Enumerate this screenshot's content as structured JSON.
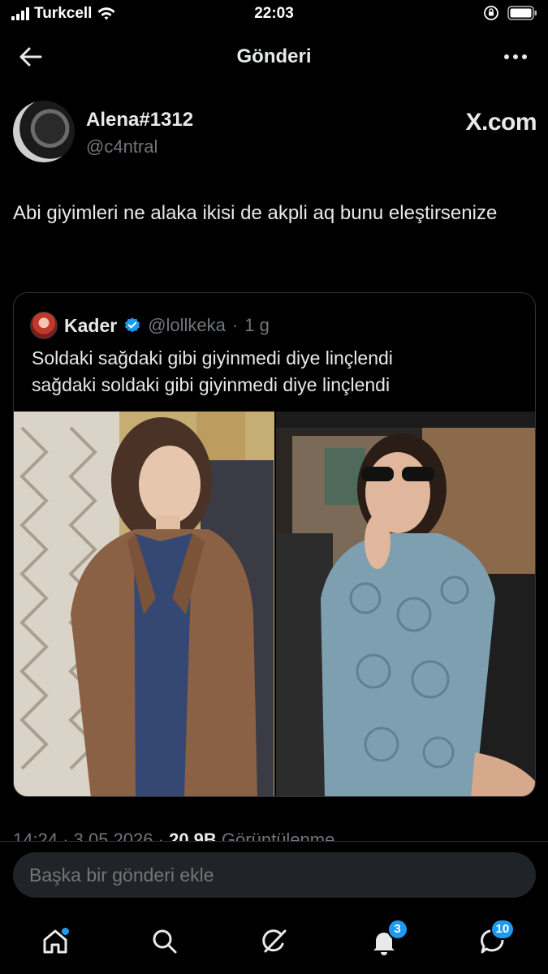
{
  "status_bar": {
    "carrier": "Turkcell",
    "time": "22:03"
  },
  "header": {
    "title": "Gönderi"
  },
  "author": {
    "name": "Alena#1312",
    "handle": "@c4ntral",
    "site_logo": "X.com"
  },
  "tweet": {
    "text": "Abi giyimleri ne alaka ikisi de akpli aq bunu eleştirsenize"
  },
  "quote": {
    "name": "Kader",
    "handle": "@lollkeka",
    "separator": "·",
    "age": "1 g",
    "text_line1": "Soldaki sağdaki gibi giyinmedi diye linçlendi",
    "text_line2": "sağdaki soldaki gibi giyinmedi diye linçlendi"
  },
  "meta": {
    "time": "14:24",
    "date": "3.05.2026",
    "views": "20,9B",
    "views_label": "Görüntülenme"
  },
  "reply": {
    "placeholder": "Başka bir gönderi ekle"
  },
  "tabbar": {
    "notifications_badge": "3",
    "messages_badge": "10"
  },
  "colors": {
    "background": "#000000",
    "accent": "#1d9bf0",
    "secondary_text": "#71767b"
  }
}
